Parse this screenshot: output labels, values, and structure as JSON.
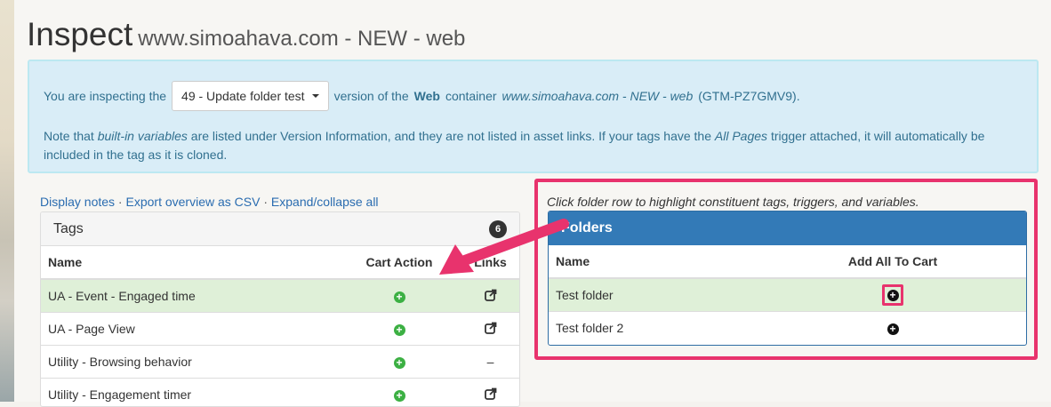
{
  "header": {
    "title": "Inspect",
    "subtitle": "www.simoahava.com - NEW - web"
  },
  "info": {
    "prefix": "You are inspecting the",
    "version_select": "49 - Update folder test",
    "text_a": "version of the",
    "bold_web": "Web",
    "text_b": "container",
    "container_name": "www.simoahava.com - NEW - web",
    "container_id": "(GTM-PZ7GMV9).",
    "note_a": "Note that",
    "note_em1": "built-in variables",
    "note_b": "are listed under Version Information, and they are not listed in asset links. If your tags have the",
    "note_em2": "All Pages",
    "note_c": "trigger attached, it will automatically be included in the tag as it is cloned."
  },
  "links": {
    "display_notes": "Display notes",
    "export_csv": "Export overview as CSV",
    "expand_collapse": "Expand/collapse all",
    "sep": " · "
  },
  "tags": {
    "title": "Tags",
    "count": "6",
    "columns": {
      "name": "Name",
      "cart_action": "Cart Action",
      "links": "Links"
    },
    "rows": [
      {
        "name": "UA - Event - Engaged time",
        "link": "ext"
      },
      {
        "name": "UA - Page View",
        "link": "ext"
      },
      {
        "name": "Utility - Browsing behavior",
        "link": "–"
      },
      {
        "name": "Utility - Engagement timer",
        "link": "ext"
      }
    ]
  },
  "folders": {
    "hint": "Click folder row to highlight constituent tags, triggers, and variables.",
    "title": "Folders",
    "columns": {
      "name": "Name",
      "add_all": "Add All To Cart"
    },
    "rows": [
      {
        "name": "Test folder"
      },
      {
        "name": "Test folder 2"
      }
    ]
  },
  "colors": {
    "accent_pink": "#e8336d",
    "panel_blue": "#337ab7",
    "info_bg": "#d9edf7",
    "highlight_row": "#dff0d8",
    "plus_green": "#3cb043"
  }
}
